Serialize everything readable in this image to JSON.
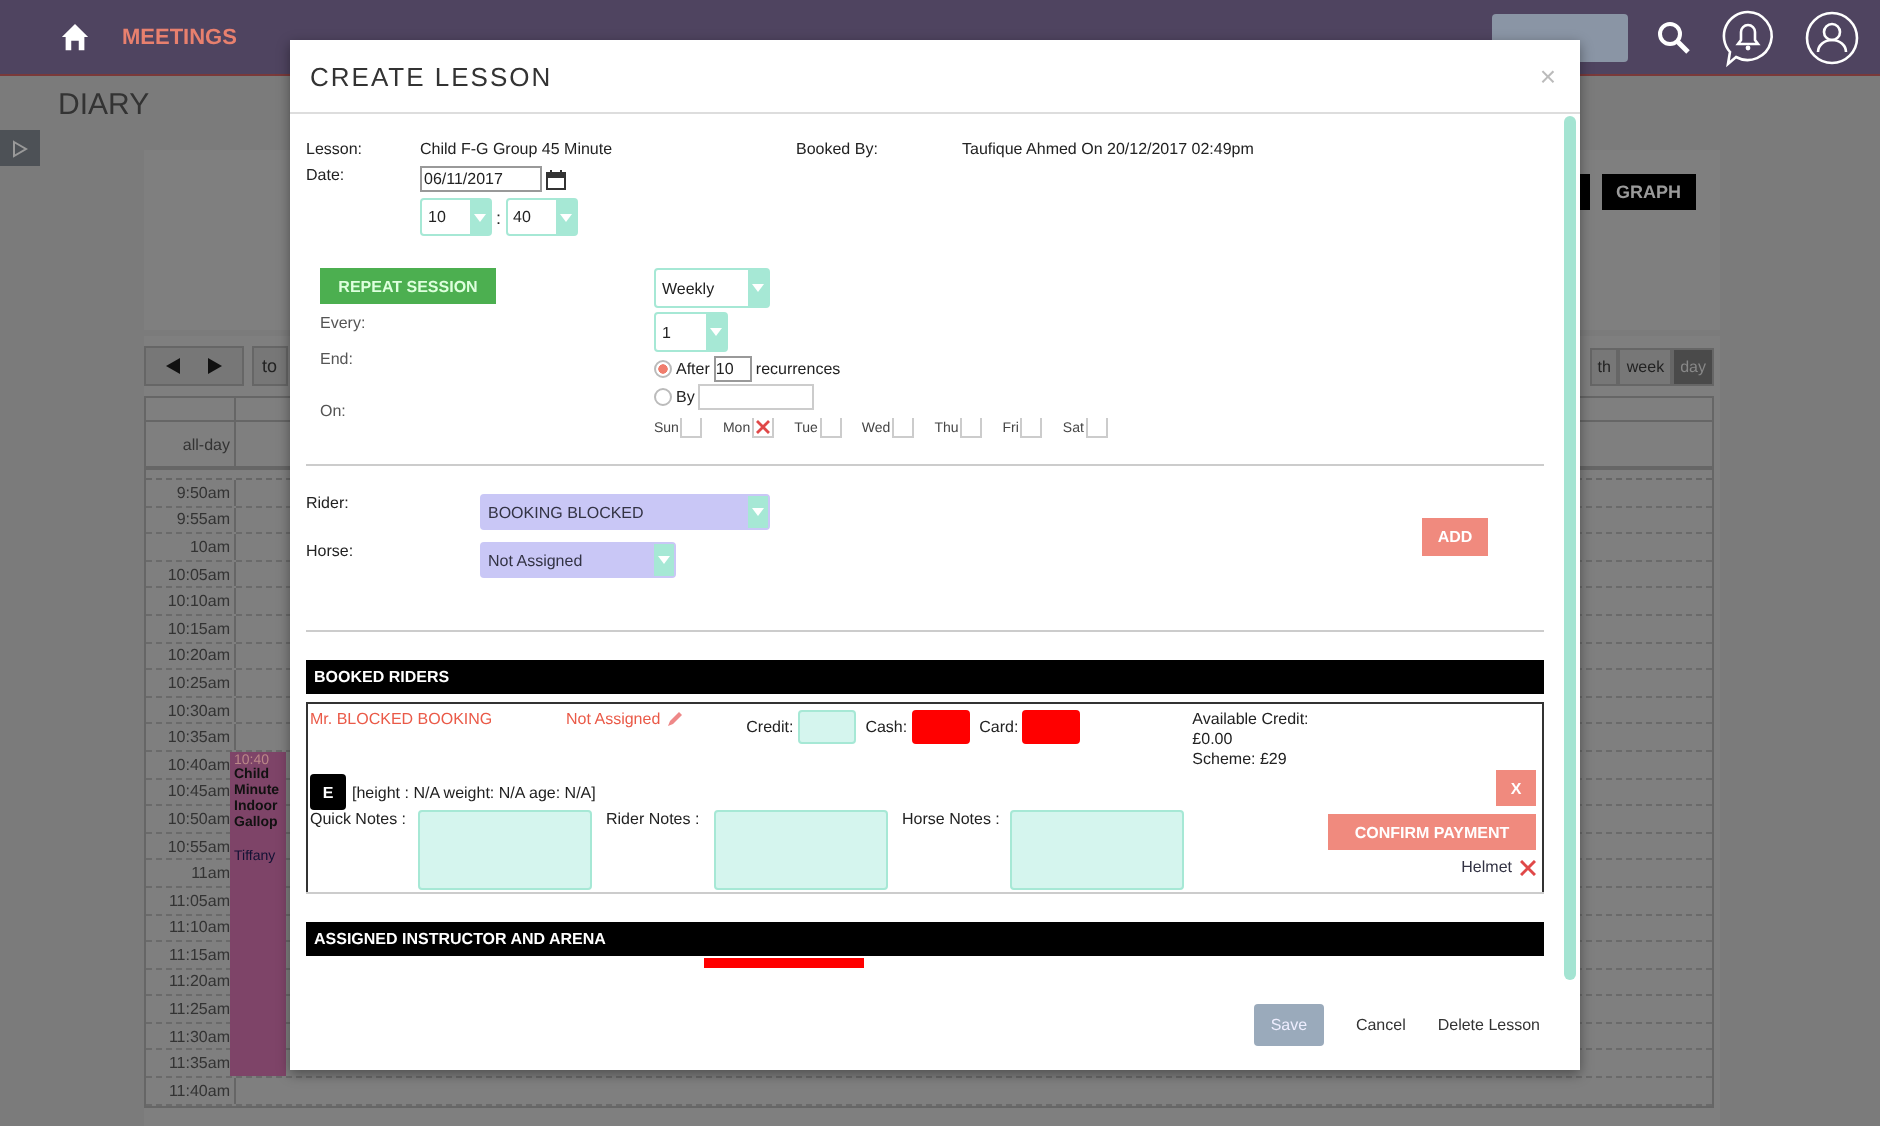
{
  "nav": {
    "items": [
      {
        "label": "MEETINGS",
        "selected": true
      }
    ]
  },
  "page_title": "DIARY",
  "calendar": {
    "today_button": "to",
    "views": [
      {
        "label": "th",
        "selected": false
      },
      {
        "label": "week",
        "selected": false
      },
      {
        "label": "day",
        "selected": true
      }
    ],
    "graph_button": "GRAPH",
    "all_day_label": "all-day",
    "times": [
      "9:50am",
      "9:55am",
      "10am",
      "10:05am",
      "10:10am",
      "10:15am",
      "10:20am",
      "10:25am",
      "10:30am",
      "10:35am",
      "10:40am",
      "10:45am",
      "10:50am",
      "10:55am",
      "11am",
      "11:05am",
      "11:10am",
      "11:15am",
      "11:20am",
      "11:25am",
      "11:30am",
      "11:35am",
      "11:40am"
    ],
    "event": {
      "time": "10:40",
      "lines": [
        "Child",
        "Minute",
        "Indoor",
        "Gallop"
      ],
      "person": "Tiffany"
    }
  },
  "modal": {
    "title": "CREATE LESSON",
    "close": "×",
    "lesson_label": "Lesson:",
    "lesson_value": "Child F-G Group 45 Minute",
    "booked_by_label": "Booked By:",
    "booked_by_value": "Taufique Ahmed On 20/12/2017 02:49pm",
    "date_label": "Date:",
    "date_value": "06/11/2017",
    "hour": "10",
    "time_separator": ":",
    "minute": "40",
    "repeat_button": "REPEAT SESSION",
    "frequency": "Weekly",
    "every_label": "Every:",
    "every_value": "1",
    "end_label": "End:",
    "on_label": "On:",
    "end_options": [
      {
        "kind": "count",
        "label": "After",
        "selected": true,
        "value": "10",
        "suffix": "recurrences"
      },
      {
        "kind": "date",
        "label": "By",
        "selected": false
      }
    ],
    "days": [
      {
        "label": "Sun",
        "checked": false
      },
      {
        "label": "Mon",
        "checked": true
      },
      {
        "label": "Tue",
        "checked": false
      },
      {
        "label": "Wed",
        "checked": false
      },
      {
        "label": "Thu",
        "checked": false
      },
      {
        "label": "Fri",
        "checked": false
      },
      {
        "label": "Sat",
        "checked": false
      }
    ],
    "rider_label": "Rider:",
    "rider_value": "BOOKING BLOCKED",
    "horse_label": "Horse:",
    "horse_value": "Not Assigned",
    "add_button": "ADD",
    "booked_riders": {
      "title": "BOOKED RIDERS",
      "name": "Mr. BLOCKED BOOKING",
      "horse": "Not Assigned",
      "payments": [
        {
          "label": "Credit:",
          "error": false
        },
        {
          "label": "Cash:",
          "error": true
        },
        {
          "label": "Card:",
          "error": true
        }
      ],
      "available_credit": [
        "Available Credit:",
        "£0.00",
        "Scheme: £29"
      ],
      "badge": "E",
      "stats": "[height : N/A weight: N/A age: N/A]",
      "remove_button": "X",
      "confirm_button": "CONFIRM PAYMENT",
      "helmet": {
        "label": "Helmet",
        "checked": true
      },
      "notes": [
        "Quick Notes :",
        "Rider Notes :",
        "Horse Notes :"
      ]
    },
    "instructor": {
      "title": "ASSIGNED INSTRUCTOR AND ARENA",
      "field_error": true
    },
    "footer": {
      "save": {
        "label": "Save",
        "disabled": true
      },
      "cancel": "Cancel",
      "delete": "Delete Lesson"
    }
  }
}
